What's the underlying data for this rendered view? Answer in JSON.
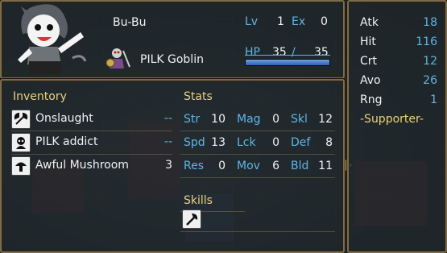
{
  "unit": {
    "name": "Bu-Bu",
    "class": "PILK Goblin",
    "lv_label": "Lv",
    "lv": "1",
    "ex_label": "Ex",
    "ex": "0",
    "hp_label": "HP",
    "hp_current": "35",
    "hp_slash": "/",
    "hp_max": "35",
    "hp_fraction": 1.0
  },
  "inventory": {
    "title": "Inventory",
    "items": [
      {
        "name": "Onslaught",
        "uses": "--",
        "icon": "axe-icon"
      },
      {
        "name": "PILK addict",
        "uses": "--",
        "icon": "portrait-icon"
      },
      {
        "name": "Awful Mushroom",
        "uses": "3",
        "icon": "mushroom-icon"
      }
    ]
  },
  "stats": {
    "title": "Stats",
    "rows": [
      [
        {
          "label": "Str",
          "value": "10"
        },
        {
          "label": "Mag",
          "value": "0"
        },
        {
          "label": "Skl",
          "value": "12"
        }
      ],
      [
        {
          "label": "Spd",
          "value": "13"
        },
        {
          "label": "Lck",
          "value": "0"
        },
        {
          "label": "Def",
          "value": "8"
        }
      ],
      [
        {
          "label": "Res",
          "value": "0"
        },
        {
          "label": "Mov",
          "value": "6"
        },
        {
          "label": "Bld",
          "value": "11"
        }
      ]
    ]
  },
  "skills": {
    "title": "Skills",
    "items": [
      {
        "icon": "axe-icon"
      }
    ]
  },
  "combat": {
    "atk_label": "Atk",
    "atk": "18",
    "hit_label": "Hit",
    "hit": "116",
    "crt_label": "Crt",
    "crt": "12",
    "avo_label": "Avo",
    "avo": "26",
    "rng_label": "Rng",
    "rng": "1",
    "role": "-Supporter-"
  },
  "colors": {
    "accent": "#5fb5e6",
    "title": "#e9d27a",
    "border": "#7d6c4a"
  }
}
